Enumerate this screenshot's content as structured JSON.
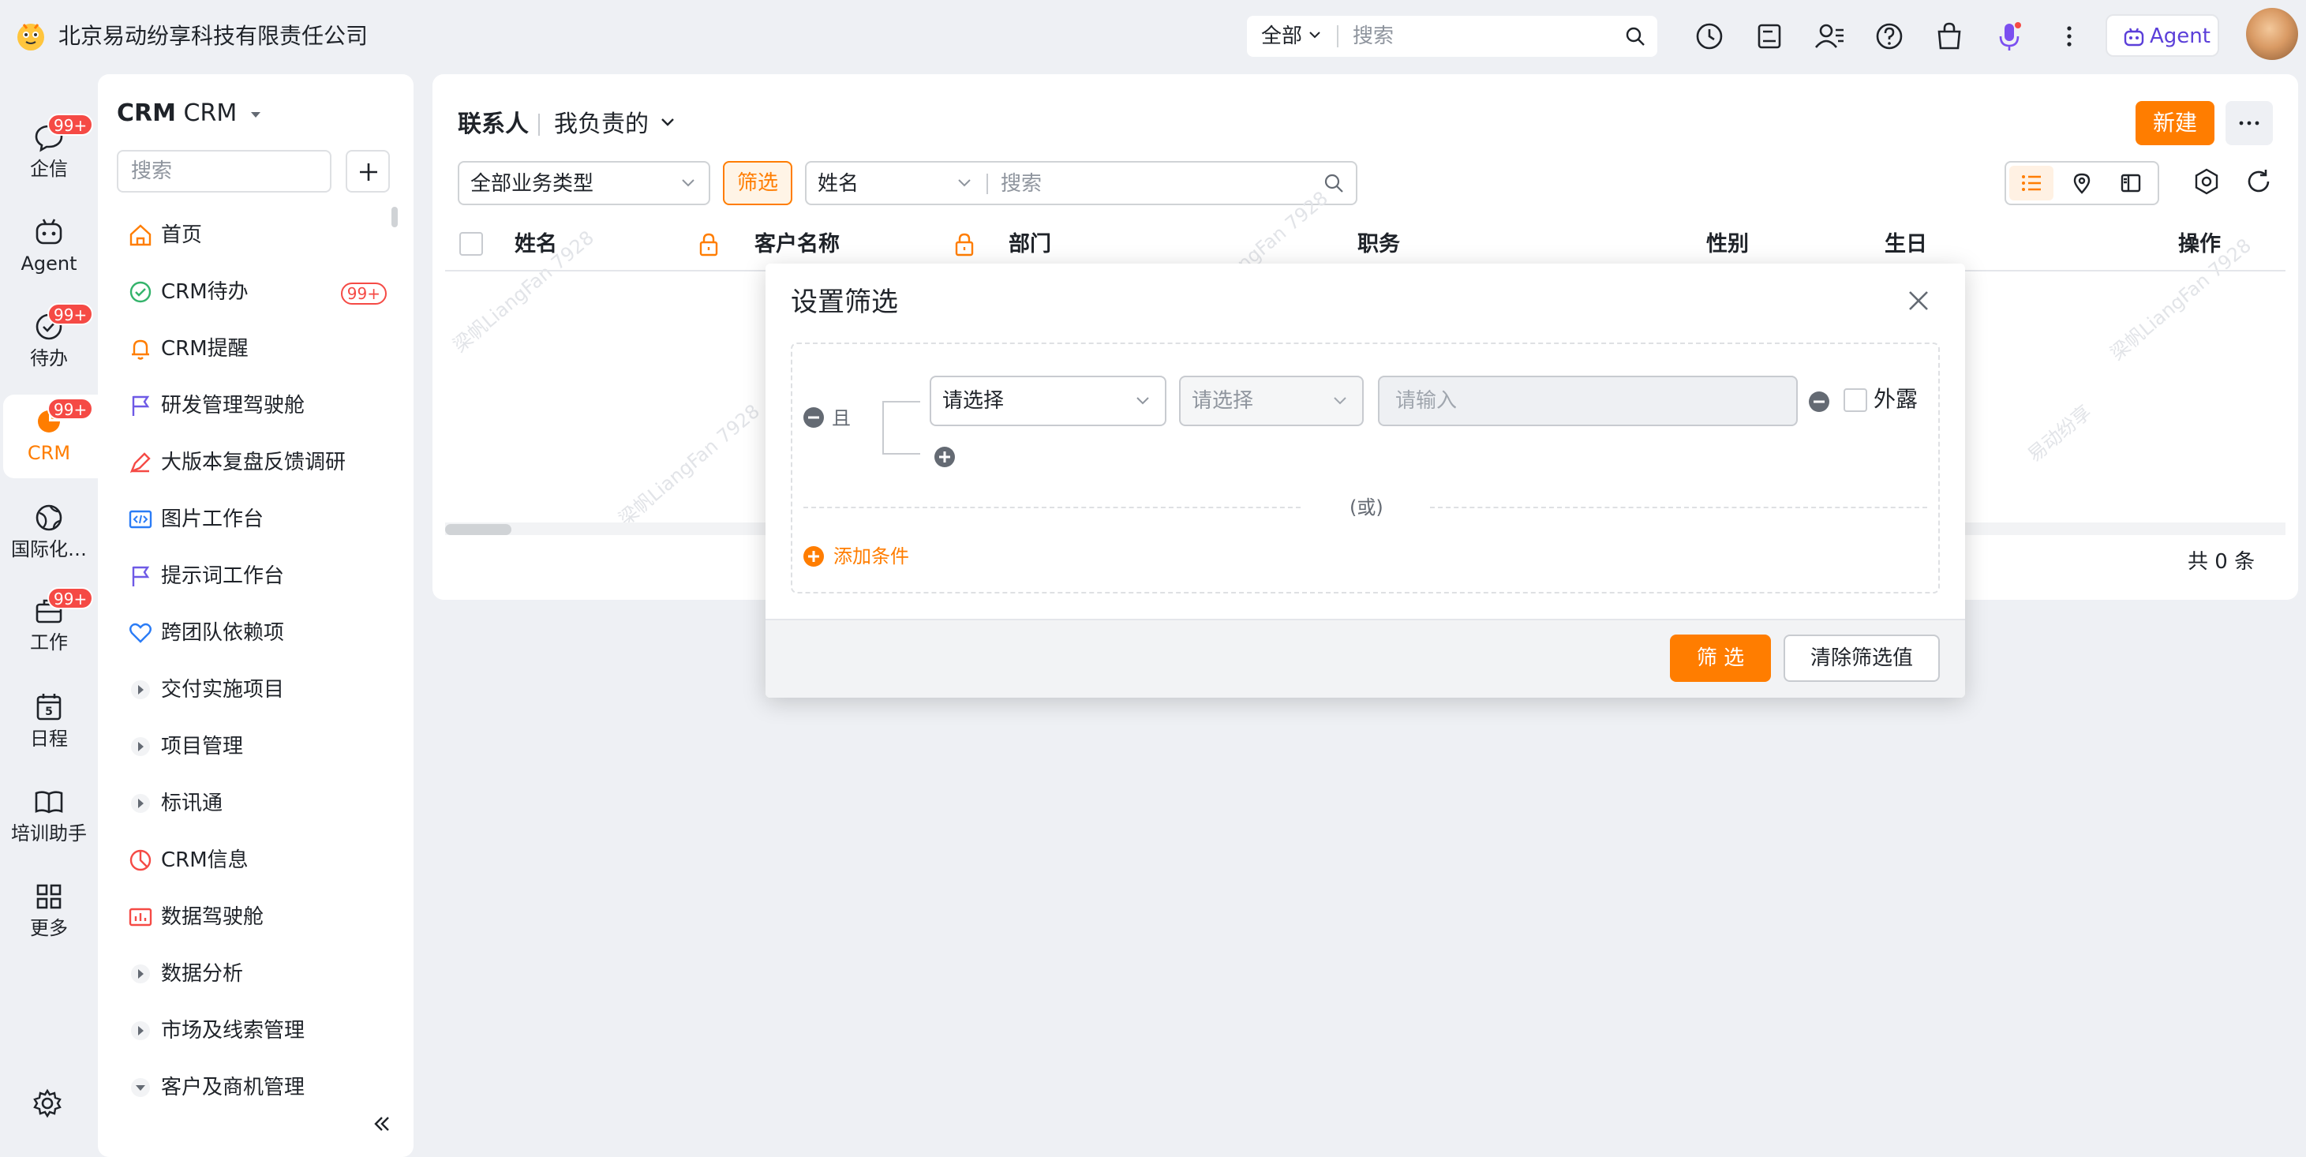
{
  "topbar": {
    "company": "北京易动纷享科技有限责任公司",
    "search_scope": "全部",
    "search_placeholder": "搜索",
    "agent_label": "Agent",
    "icons": [
      "history-icon",
      "notes-icon",
      "contacts-icon",
      "help-icon",
      "bag-icon",
      "mic-icon",
      "more-vertical-icon"
    ]
  },
  "rail": {
    "items": [
      {
        "label": "企信",
        "badge": "99+",
        "icon": "chat-icon"
      },
      {
        "label": "Agent",
        "badge": "",
        "icon": "robot-icon"
      },
      {
        "label": "待办",
        "badge": "99+",
        "icon": "check-circle-icon"
      },
      {
        "label": "CRM",
        "badge": "99+",
        "icon": "pie-chart-icon",
        "active": true
      },
      {
        "label": "国际化…",
        "badge": "",
        "icon": "globe-icon"
      },
      {
        "label": "工作",
        "badge": "99+",
        "icon": "briefcase-icon"
      },
      {
        "label": "日程",
        "badge": "",
        "icon": "calendar-icon",
        "day": "5"
      },
      {
        "label": "培训助手",
        "badge": "",
        "icon": "book-icon"
      },
      {
        "label": "更多",
        "badge": "",
        "icon": "grid-icon"
      }
    ]
  },
  "nav": {
    "title_bold": "CRM",
    "title_sub": "CRM",
    "search_placeholder": "搜索",
    "items": [
      {
        "label": "首页",
        "icon": "home-icon",
        "badge": ""
      },
      {
        "label": "CRM待办",
        "icon": "todo-check-icon",
        "badge": "99+"
      },
      {
        "label": "CRM提醒",
        "icon": "bell-icon",
        "badge": ""
      },
      {
        "label": "研发管理驾驶舱",
        "icon": "flag-icon",
        "badge": ""
      },
      {
        "label": "大版本复盘反馈调研",
        "icon": "feedback-icon",
        "badge": ""
      },
      {
        "label": "图片工作台",
        "icon": "code-image-icon",
        "badge": ""
      },
      {
        "label": "提示词工作台",
        "icon": "flag-icon",
        "badge": ""
      },
      {
        "label": "跨团队依赖项",
        "icon": "heart-icon",
        "badge": ""
      },
      {
        "label": "交付实施项目",
        "icon": "caret-right-icon",
        "badge": ""
      },
      {
        "label": "项目管理",
        "icon": "caret-right-icon",
        "badge": ""
      },
      {
        "label": "标讯通",
        "icon": "caret-right-icon",
        "badge": ""
      },
      {
        "label": "CRM信息",
        "icon": "pie-icon",
        "badge": ""
      },
      {
        "label": "数据驾驶舱",
        "icon": "dashboard-icon",
        "badge": ""
      },
      {
        "label": "数据分析",
        "icon": "caret-right-icon",
        "badge": ""
      },
      {
        "label": "市场及线索管理",
        "icon": "caret-right-icon",
        "badge": ""
      },
      {
        "label": "客户及商机管理",
        "icon": "caret-down-icon",
        "badge": ""
      }
    ]
  },
  "main": {
    "object_name": "联系人",
    "view_name": "我负责的",
    "new_label": "新建",
    "biz_type": "全部业务类型",
    "filter_label": "筛选",
    "search_field": "姓名",
    "search_placeholder": "搜索",
    "columns": [
      "姓名",
      "客户名称",
      "部门",
      "职务",
      "性别",
      "生日",
      "操作"
    ],
    "total": "共 0 条",
    "watermark": "梁帆LiangFan 7928",
    "watermark2": "易动纷享"
  },
  "modal": {
    "title": "设置筛选",
    "and_label": "且",
    "field_placeholder": "请选择",
    "operator_placeholder": "请选择",
    "value_placeholder": "请输入",
    "expose_label": "外露",
    "or_label": "(或)",
    "add_condition": "添加条件",
    "apply_label": "筛 选",
    "clear_label": "清除筛选值"
  },
  "colors": {
    "accent": "#ff7d00",
    "badge_red": "#f54a45",
    "agent_purple": "#5b3fd9",
    "background": "#eef0f4"
  }
}
